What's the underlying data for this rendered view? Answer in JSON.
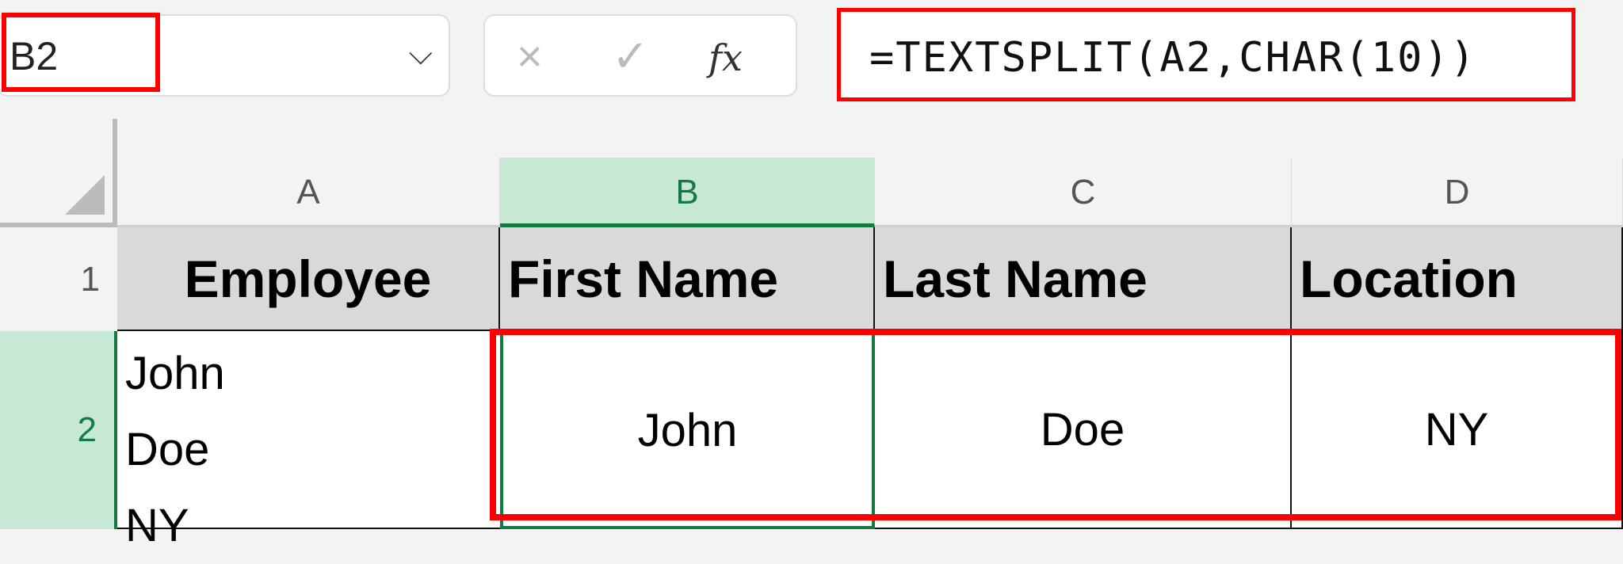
{
  "name_box": {
    "value": "B2"
  },
  "formula_bar": {
    "cancel_icon": "×",
    "enter_icon": "✓",
    "fx_label": "fx",
    "formula": "=TEXTSPLIT(A2,CHAR(10))"
  },
  "columns": [
    "A",
    "B",
    "C",
    "D"
  ],
  "rows": [
    "1",
    "2"
  ],
  "headers": [
    "Employee",
    "First Name",
    "Last Name",
    "Location"
  ],
  "row2": {
    "a_lines": [
      "John",
      "Doe",
      "NY"
    ],
    "b": "John",
    "c": "Doe",
    "d": "NY"
  },
  "colors": {
    "highlight": "#ff0000",
    "selection": "#137a43"
  }
}
